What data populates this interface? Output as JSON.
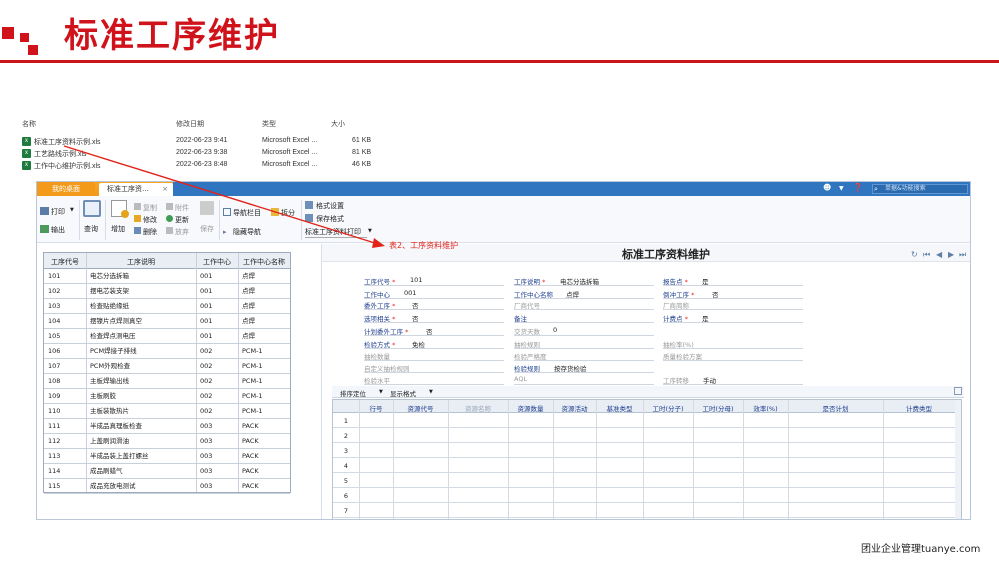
{
  "slide": {
    "title": "标准工序维护",
    "footer": "团业企业管理tuanye.com",
    "annotation": "表2、工序资料维护",
    "accent": "#d0121b"
  },
  "explorer": {
    "headers": [
      "名称",
      "修改日期",
      "类型",
      "大小"
    ],
    "files": [
      {
        "name": "标准工序资料示例.xls",
        "date": "2022-06-23 9:41",
        "type": "Microsoft Excel ...",
        "size": "61 KB"
      },
      {
        "name": "工艺路线示例.xls",
        "date": "2022-06-23 9:38",
        "type": "Microsoft Excel ...",
        "size": "81 KB"
      },
      {
        "name": "工作中心维护示例.xls",
        "date": "2022-06-23 8:48",
        "type": "Microsoft Excel ...",
        "size": "46 KB"
      }
    ]
  },
  "app": {
    "tabs": {
      "home": "我的桌面",
      "active": "标准工序资…",
      "close": "×"
    },
    "search_placeholder": "单据&功能搜索",
    "toolbar": {
      "print": "打印",
      "export": "输出",
      "query": "查询",
      "add": "增加",
      "copy": "复制",
      "modify": "修改",
      "delete": "删除",
      "attach": "附件",
      "update": "更新",
      "restore": "放弃",
      "save": "保存",
      "nav_column": "导航栏目",
      "hide_nav": "隐藏导航",
      "split": "拆分",
      "format_set": "格式设置",
      "save_format": "保存格式",
      "format_select": "标准工序资料打印"
    },
    "left_grid": {
      "headers": [
        "工序代号",
        "工序说明",
        "工作中心",
        "工作中心名称"
      ],
      "rows": [
        [
          "101",
          "电芯分选拆箱",
          "001",
          "点焊"
        ],
        [
          "102",
          "摆电芯装支架",
          "001",
          "点焊"
        ],
        [
          "103",
          "检查贴绝缘纸",
          "001",
          "点焊"
        ],
        [
          "104",
          "摆镍片点焊测真空",
          "001",
          "点焊"
        ],
        [
          "105",
          "检查焊点测电压",
          "001",
          "点焊"
        ],
        [
          "106",
          "PCM焊接子排线",
          "002",
          "PCM-1"
        ],
        [
          "107",
          "PCM外观检查",
          "002",
          "PCM-1"
        ],
        [
          "108",
          "主板焊输出线",
          "002",
          "PCM-1"
        ],
        [
          "109",
          "主板刷胶",
          "002",
          "PCM-1"
        ],
        [
          "110",
          "主板装散热片",
          "002",
          "PCM-1"
        ],
        [
          "111",
          "半成品真理板检查",
          "003",
          "PACK"
        ],
        [
          "112",
          "上盖刷润滑油",
          "003",
          "PACK"
        ],
        [
          "113",
          "半成品装上盖打螺丝",
          "003",
          "PACK"
        ],
        [
          "114",
          "成品刷蜡气",
          "003",
          "PACK"
        ],
        [
          "115",
          "成品充放电测试",
          "003",
          "PACK"
        ]
      ]
    },
    "form": {
      "title": "标准工序资料维护",
      "fields": {
        "op_code": {
          "label": "工序代号",
          "value": "101"
        },
        "op_desc": {
          "label": "工序说明",
          "value": "电芯分选拆箱"
        },
        "report_point": {
          "label": "报告点",
          "value": "是"
        },
        "work_center": {
          "label": "工作中心",
          "value": "001"
        },
        "wc_name": {
          "label": "工作中心名称",
          "value": "点焊"
        },
        "control_op": {
          "label": "倒冲工序",
          "value": "否"
        },
        "outsource_op": {
          "label": "委外工序",
          "value": "否"
        },
        "vendor_code": {
          "label": "厂商代号",
          "value": ""
        },
        "vendor_short": {
          "label": "厂商简称",
          "value": ""
        },
        "option_related": {
          "label": "选项相关",
          "value": "否"
        },
        "remark": {
          "label": "备注",
          "value": ""
        },
        "count_point": {
          "label": "计费点",
          "value": "是"
        },
        "plan_outsource": {
          "label": "计划委外工序",
          "value": "否"
        },
        "lead_days": {
          "label": "交货天数",
          "value": "0"
        },
        "inspect_mode": {
          "label": "检验方式",
          "value": "免检"
        },
        "sample_rule": {
          "label": "抽检规则",
          "value": ""
        },
        "sample_rate": {
          "label": "抽检率(%)",
          "value": ""
        },
        "sample_qty": {
          "label": "抽检数量",
          "value": ""
        },
        "inspect_strict": {
          "label": "检验严格度",
          "value": ""
        },
        "quality_plan": {
          "label": "质量检验方案",
          "value": ""
        },
        "custom_rule": {
          "label": "自定义抽检规则",
          "value": ""
        },
        "inspect_rule": {
          "label": "检验规则",
          "value": "按存货检验"
        },
        "inspect_level": {
          "label": "检验水平",
          "value": ""
        },
        "aql": {
          "label": "AQL",
          "value": ""
        },
        "op_transfer": {
          "label": "工序转移",
          "value": "手动"
        }
      },
      "sub_toolbar": {
        "sort": "排序定位",
        "display": "显示格式"
      },
      "resource_grid": {
        "headers": [
          "行号",
          "资源代号",
          "资源名称",
          "资源数量",
          "资源活动",
          "基准类型",
          "工时(分子)",
          "工时(分母)",
          "效率(%)",
          "是否计划",
          "计费类型"
        ],
        "row_numbers": [
          "1",
          "2",
          "3",
          "4",
          "5",
          "6",
          "7"
        ]
      }
    }
  }
}
